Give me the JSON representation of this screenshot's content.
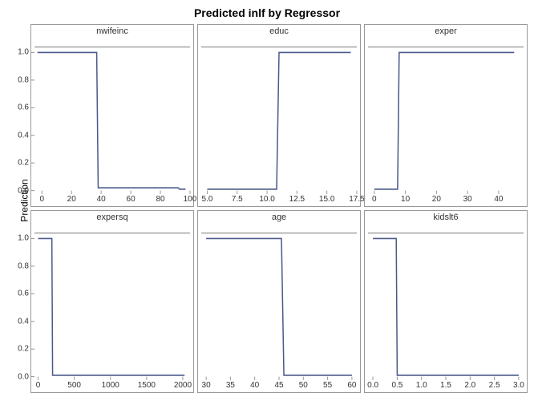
{
  "title": "Predicted inlf by Regressor",
  "ylabel": "Prediction",
  "ylim": [
    0,
    1.1
  ],
  "yticks": [
    0.0,
    0.2,
    0.4,
    0.6,
    0.8,
    1.0
  ],
  "refline_y": 1.04,
  "panels": [
    {
      "name": "nwifeinc",
      "xlim": [
        -5,
        100
      ],
      "xticks": [
        0,
        20,
        40,
        60,
        80,
        100
      ],
      "data": [
        {
          "x": -3,
          "y": 1.0
        },
        {
          "x": 37,
          "y": 1.0
        },
        {
          "x": 38,
          "y": 0.02
        },
        {
          "x": 92,
          "y": 0.02
        },
        {
          "x": 93,
          "y": 0.01
        },
        {
          "x": 97,
          "y": 0.01
        }
      ]
    },
    {
      "name": "educ",
      "xlim": [
        4.5,
        17.5
      ],
      "xticks": [
        5.0,
        7.5,
        10.0,
        12.5,
        15.0,
        17.5
      ],
      "data": [
        {
          "x": 5.0,
          "y": 0.01
        },
        {
          "x": 10.8,
          "y": 0.01
        },
        {
          "x": 11.0,
          "y": 1.0
        },
        {
          "x": 17.0,
          "y": 1.0
        }
      ]
    },
    {
      "name": "exper",
      "xlim": [
        -2,
        48
      ],
      "xticks": [
        0,
        10,
        20,
        30,
        40
      ],
      "data": [
        {
          "x": 0,
          "y": 0.01
        },
        {
          "x": 7.5,
          "y": 0.01
        },
        {
          "x": 8,
          "y": 1.0
        },
        {
          "x": 45,
          "y": 1.0
        }
      ]
    },
    {
      "name": "expersq",
      "xlim": [
        -50,
        2100
      ],
      "xticks": [
        0,
        500,
        1000,
        1500,
        2000
      ],
      "data": [
        {
          "x": 0,
          "y": 1.0
        },
        {
          "x": 190,
          "y": 1.0
        },
        {
          "x": 200,
          "y": 0.01
        },
        {
          "x": 2025,
          "y": 0.01
        }
      ]
    },
    {
      "name": "age",
      "xlim": [
        29,
        61
      ],
      "xticks": [
        30,
        35,
        40,
        45,
        50,
        55,
        60
      ],
      "data": [
        {
          "x": 30,
          "y": 1.0
        },
        {
          "x": 45.5,
          "y": 1.0
        },
        {
          "x": 46,
          "y": 0.01
        },
        {
          "x": 60,
          "y": 0.01
        }
      ]
    },
    {
      "name": "kidslt6",
      "xlim": [
        -0.1,
        3.1
      ],
      "xticks": [
        0.0,
        0.5,
        1.0,
        1.5,
        2.0,
        2.5,
        3.0
      ],
      "data": [
        {
          "x": 0,
          "y": 1.0
        },
        {
          "x": 0.48,
          "y": 1.0
        },
        {
          "x": 0.5,
          "y": 0.01
        },
        {
          "x": 3.0,
          "y": 0.01
        }
      ]
    }
  ],
  "chart_data": {
    "type": "line",
    "title": "Predicted inlf by Regressor",
    "ylabel": "Prediction",
    "ylim": [
      0,
      1.1
    ],
    "reference_line": 1.04,
    "series": [
      {
        "name": "nwifeinc",
        "x": [
          -3,
          37,
          38,
          92,
          93,
          97
        ],
        "y": [
          1.0,
          1.0,
          0.02,
          0.02,
          0.01,
          0.01
        ],
        "xlim": [
          -5,
          100
        ]
      },
      {
        "name": "educ",
        "x": [
          5.0,
          10.8,
          11.0,
          17.0
        ],
        "y": [
          0.01,
          0.01,
          1.0,
          1.0
        ],
        "xlim": [
          4.5,
          17.5
        ]
      },
      {
        "name": "exper",
        "x": [
          0,
          7.5,
          8,
          45
        ],
        "y": [
          0.01,
          0.01,
          1.0,
          1.0
        ],
        "xlim": [
          -2,
          48
        ]
      },
      {
        "name": "expersq",
        "x": [
          0,
          190,
          200,
          2025
        ],
        "y": [
          1.0,
          1.0,
          0.01,
          0.01
        ],
        "xlim": [
          -50,
          2100
        ]
      },
      {
        "name": "age",
        "x": [
          30,
          45.5,
          46,
          60
        ],
        "y": [
          1.0,
          1.0,
          0.01,
          0.01
        ],
        "xlim": [
          29,
          61
        ]
      },
      {
        "name": "kidslt6",
        "x": [
          0,
          0.48,
          0.5,
          3.0
        ],
        "y": [
          1.0,
          1.0,
          0.01,
          0.01
        ],
        "xlim": [
          -0.1,
          3.1
        ]
      }
    ]
  }
}
